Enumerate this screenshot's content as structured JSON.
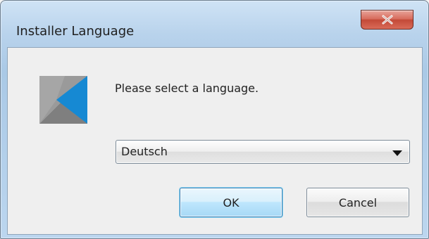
{
  "window": {
    "title": "Installer Language"
  },
  "dialog": {
    "prompt": "Please select a language.",
    "language_select": {
      "value": "Deutsch"
    },
    "buttons": {
      "ok": "OK",
      "cancel": "Cancel"
    }
  },
  "icons": {
    "app": "installer-logo-icon",
    "close": "close-icon",
    "dropdown": "chevron-down-icon"
  },
  "colors": {
    "title_bar": "#b9d3ec",
    "close_button": "#d86d5e",
    "logo_blue": "#1f8ed6",
    "logo_gray": "#8c8c8c",
    "ok_button": "#bee6fd"
  }
}
